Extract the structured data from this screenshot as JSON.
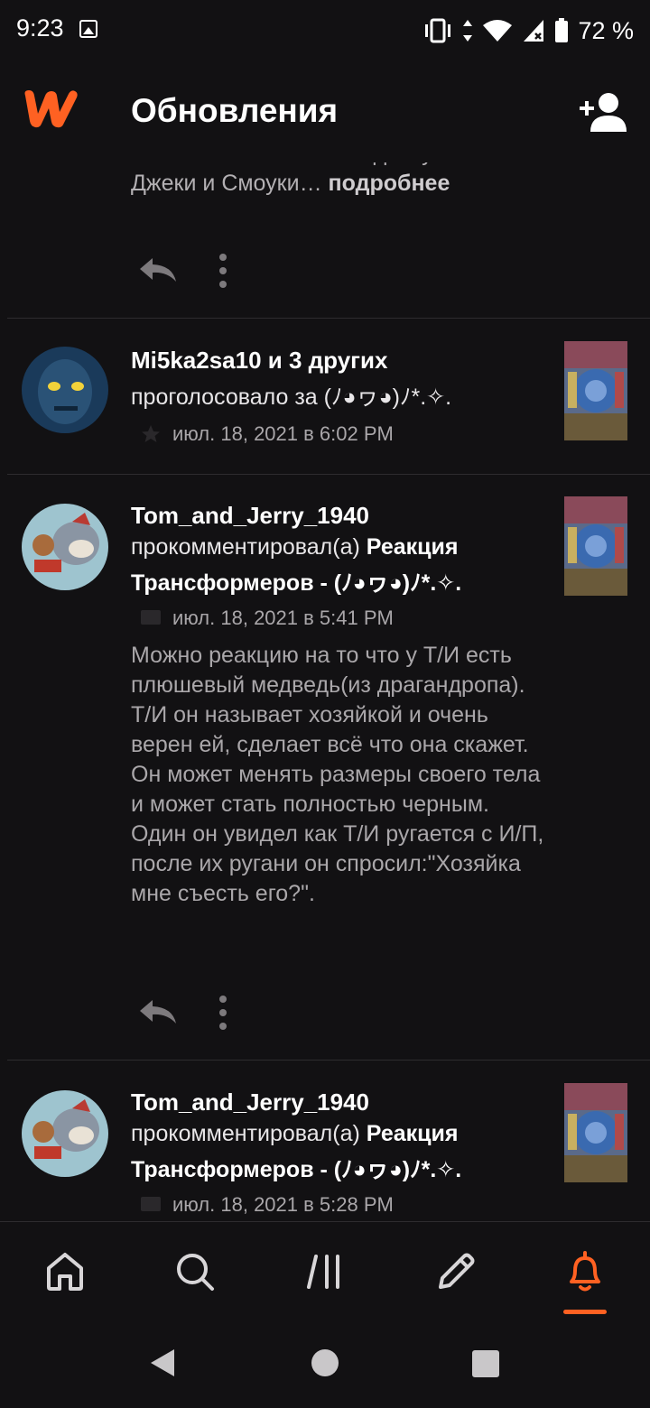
{
  "status_bar": {
    "time": "9:23",
    "battery": "72 %"
  },
  "header": {
    "title": "Обновления"
  },
  "feed": {
    "snippet": {
      "text": "то что Т/И хочет на свиданку с Джеки и Смоуки…",
      "more": "подробнее"
    },
    "items": [
      {
        "name": "Mi5ka2sa10 и 3 других",
        "action": "проголосовало за (ﾉ◕ヮ◕)ﾉ*.✧.",
        "date": "июл. 18, 2021 в 6:02 PM"
      },
      {
        "name": "Tom_and_Jerry_1940",
        "action": "прокомментировал(а)",
        "story": "Реакция Трансформеров - (ﾉ◕ヮ◕)ﾉ*.✧.",
        "date": "июл. 18, 2021 в 5:41 PM",
        "comment": "Можно реакцию на то что у Т/И есть плюшевый медведь(из драгандропа). Т/И он называет хозяйкой и очень верен ей, сделает всё что она скажет. Он может менять размеры своего тела и может стать полностью черным. Один он увидел как Т/И ругается с И/П, после их ругани он спросил:\"Хозяйка мне съесть его?\"."
      },
      {
        "name": "Tom_and_Jerry_1940",
        "action": "прокомментировал(а)",
        "story": "Реакция Трансформеров - (ﾉ◕ヮ◕)ﾉ*.✧.",
        "date": "июл. 18, 2021 в 5:28 PM"
      }
    ]
  },
  "colors": {
    "accent": "#ff6122",
    "background": "#121113",
    "divider": "#2e2c2f"
  },
  "icons": {
    "header": [
      "wattpad-logo-icon",
      "add-user-icon"
    ],
    "nav": [
      "home-icon",
      "search-icon",
      "library-icon",
      "pencil-icon",
      "bell-icon"
    ],
    "item": [
      "reply-icon",
      "more-vertical-icon",
      "star-icon",
      "comment-icon"
    ]
  },
  "bottom_nav": {
    "active": "notifications"
  }
}
